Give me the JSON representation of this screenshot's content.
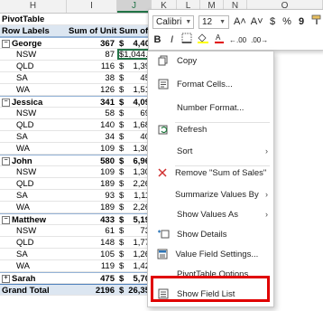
{
  "columns": [
    "H",
    "I",
    "J",
    "K",
    "L",
    "M",
    "N",
    "O"
  ],
  "pivot": {
    "title": "PivotTable",
    "header": {
      "row_labels": "Row Labels",
      "units": "Sum of Units",
      "sales": "Sum of S"
    },
    "rows": [
      {
        "type": "person",
        "label": "George",
        "units": "367",
        "dollar": "$",
        "sales": "4,40"
      },
      {
        "type": "sub",
        "label": "NSW",
        "units": "87",
        "dollar": "$",
        "sales": "1,044.00",
        "selected": true
      },
      {
        "type": "sub",
        "label": "QLD",
        "units": "116",
        "dollar": "$",
        "sales": "1,39"
      },
      {
        "type": "sub",
        "label": "SA",
        "units": "38",
        "dollar": "$",
        "sales": "45"
      },
      {
        "type": "sub",
        "label": "WA",
        "units": "126",
        "dollar": "$",
        "sales": "1,51"
      },
      {
        "type": "person",
        "label": "Jessica",
        "units": "341",
        "dollar": "$",
        "sales": "4,09"
      },
      {
        "type": "sub",
        "label": "NSW",
        "units": "58",
        "dollar": "$",
        "sales": "69"
      },
      {
        "type": "sub",
        "label": "QLD",
        "units": "140",
        "dollar": "$",
        "sales": "1,68"
      },
      {
        "type": "sub",
        "label": "SA",
        "units": "34",
        "dollar": "$",
        "sales": "40"
      },
      {
        "type": "sub",
        "label": "WA",
        "units": "109",
        "dollar": "$",
        "sales": "1,30"
      },
      {
        "type": "person",
        "label": "John",
        "units": "580",
        "dollar": "$",
        "sales": "6,96"
      },
      {
        "type": "sub",
        "label": "NSW",
        "units": "109",
        "dollar": "$",
        "sales": "1,30"
      },
      {
        "type": "sub",
        "label": "QLD",
        "units": "189",
        "dollar": "$",
        "sales": "2,26"
      },
      {
        "type": "sub",
        "label": "SA",
        "units": "93",
        "dollar": "$",
        "sales": "1,11"
      },
      {
        "type": "sub",
        "label": "WA",
        "units": "189",
        "dollar": "$",
        "sales": "2,26"
      },
      {
        "type": "person",
        "label": "Matthew",
        "units": "433",
        "dollar": "$",
        "sales": "5,19"
      },
      {
        "type": "sub",
        "label": "NSW",
        "units": "61",
        "dollar": "$",
        "sales": "73"
      },
      {
        "type": "sub",
        "label": "QLD",
        "units": "148",
        "dollar": "$",
        "sales": "1,77"
      },
      {
        "type": "sub",
        "label": "SA",
        "units": "105",
        "dollar": "$",
        "sales": "1,26"
      },
      {
        "type": "sub",
        "label": "WA",
        "units": "119",
        "dollar": "$",
        "sales": "1,42"
      },
      {
        "type": "person-collapsed",
        "label": "Sarah",
        "units": "475",
        "dollar": "$",
        "sales": "5,70"
      },
      {
        "type": "grand",
        "label": "Grand Total",
        "units": "2196",
        "dollar": "$",
        "sales": "26,35"
      }
    ]
  },
  "mini_toolbar": {
    "font_name": "Calibri",
    "font_size": "12",
    "grow_font": "A˄",
    "shrink_font": "A˅",
    "currency": "$",
    "percent": "%",
    "comma": "9",
    "bold": "B",
    "italic": "I",
    "border_icon": "border-icon",
    "fill_icon": "fill-color-icon",
    "font_color_icon": "font-color-icon",
    "decrease_decimal": "←.00",
    "increase_decimal": ".00→",
    "format_painter_icon": "format-painter-icon"
  },
  "context_menu": [
    {
      "label": "Copy",
      "icon": "copy-icon",
      "submenu": false
    },
    {
      "label": "Format Cells...",
      "icon": "format-cells-icon",
      "submenu": false
    },
    {
      "label": "Number Format...",
      "icon": "",
      "submenu": false
    },
    {
      "label": "Refresh",
      "icon": "refresh-icon",
      "submenu": false
    },
    {
      "label": "Sort",
      "icon": "",
      "submenu": true
    },
    {
      "label": "Remove \"Sum of Sales\"",
      "icon": "remove-icon",
      "submenu": false
    },
    {
      "label": "Summarize Values By",
      "icon": "",
      "submenu": true
    },
    {
      "label": "Show Values As",
      "icon": "",
      "submenu": true
    },
    {
      "label": "Show Details",
      "icon": "show-details-icon",
      "submenu": false
    },
    {
      "label": "Value Field Settings...",
      "icon": "value-field-settings-icon",
      "submenu": false
    },
    {
      "label": "PivotTable Options...",
      "icon": "",
      "submenu": false
    },
    {
      "label": "Show Field List",
      "icon": "field-list-icon",
      "submenu": false
    }
  ],
  "submenu_arrow": "›",
  "colors": {
    "accent": "#217346",
    "highlight": "#e00000",
    "pivot_header": "#dce6f1"
  }
}
